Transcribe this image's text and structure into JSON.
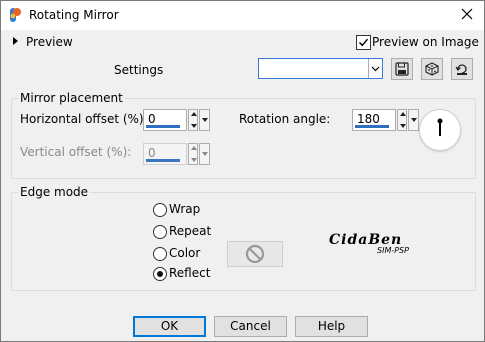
{
  "window": {
    "title": "Rotating Mirror"
  },
  "preview": {
    "label": "Preview",
    "preview_on_image_label": "Preview on Image",
    "preview_on_image_checked": true
  },
  "settings": {
    "label": "Settings",
    "value": ""
  },
  "toolbar_icons": [
    "save-icon",
    "randomize-dice-icon",
    "reset-icon"
  ],
  "mirror_placement": {
    "title": "Mirror placement",
    "horizontal_offset_label": "Horizontal offset (%):",
    "horizontal_offset_value": "0",
    "vertical_offset_label": "Vertical offset (%):",
    "vertical_offset_value": "0",
    "rotation_angle_label": "Rotation angle:",
    "rotation_angle_value": "180"
  },
  "edge_mode": {
    "title": "Edge mode",
    "options": [
      "Wrap",
      "Repeat",
      "Color",
      "Reflect"
    ],
    "selected": "Reflect"
  },
  "watermark": {
    "line1": "CidaBen",
    "line2": "SIM-PSP"
  },
  "buttons": {
    "ok": "OK",
    "cancel": "Cancel",
    "help": "Help"
  },
  "colors": {
    "accent": "#0078d7",
    "field_bar": "#2f6fc2"
  }
}
